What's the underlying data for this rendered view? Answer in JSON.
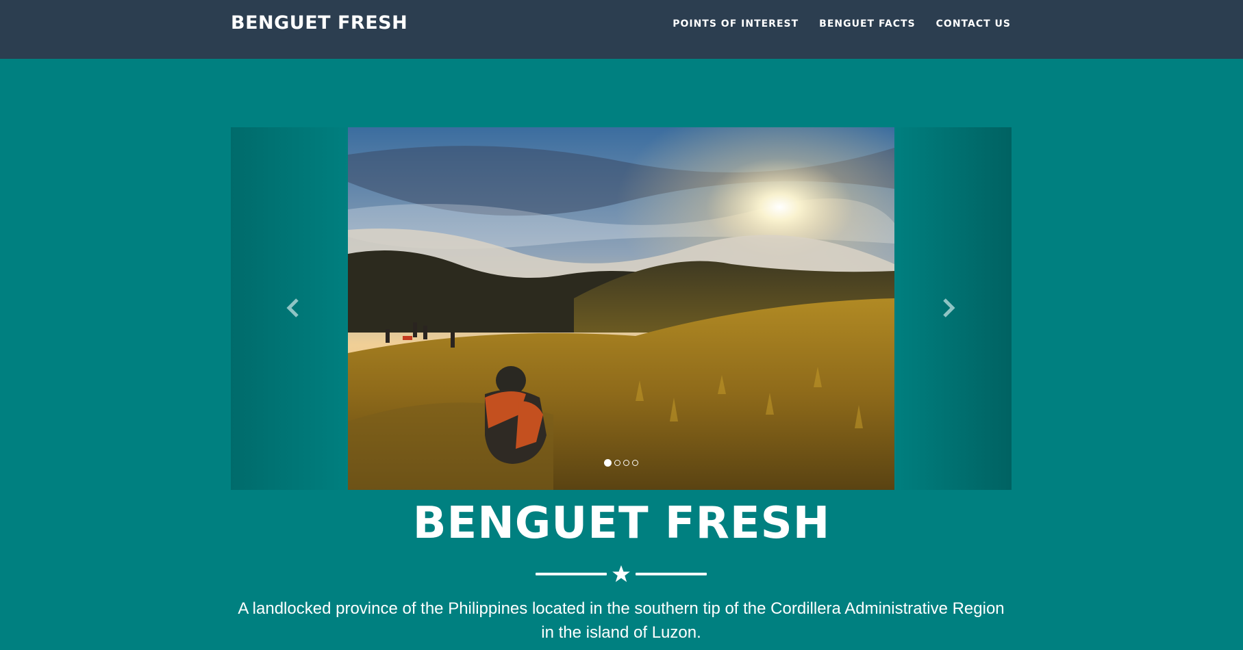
{
  "navbar": {
    "brand": "BENGUET FRESH",
    "links": [
      "POINTS OF INTEREST",
      "BENGUET FACTS",
      "CONTACT US"
    ]
  },
  "carousel": {
    "prev_icon": "chevron-left-icon",
    "next_icon": "chevron-right-icon",
    "slide_description": "mountain landscape photo",
    "indicator_count": 4,
    "active_index": 0
  },
  "hero": {
    "title": "BENGUET FRESH",
    "divider_icon": "star-icon",
    "tagline": "A landlocked province of the Philippines located in the southern tip of the Cordillera Administrative Region in the island of Luzon."
  },
  "colors": {
    "navbar_bg": "#2c3e50",
    "page_bg": "#008080",
    "text": "#ffffff"
  }
}
